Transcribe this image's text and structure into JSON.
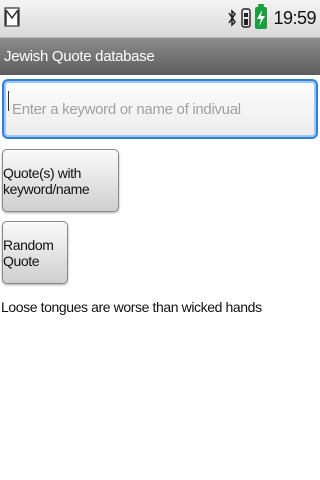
{
  "status_bar": {
    "time": "19:59",
    "icons": [
      "gmail-icon",
      "bluetooth-icon",
      "signal-icon",
      "battery-charging-icon"
    ],
    "battery_color": "#1aa040"
  },
  "title_bar": {
    "title": "Jewish Quote database"
  },
  "search": {
    "value": "",
    "placeholder": "Enter a keyword or name of indivual",
    "focus_color": "#2f7fe0"
  },
  "buttons": {
    "keyword_label": "Quote(s) with keyword/name",
    "random_label": "Random Quote"
  },
  "result": {
    "quote": "Loose tongues are worse than wicked hands"
  }
}
